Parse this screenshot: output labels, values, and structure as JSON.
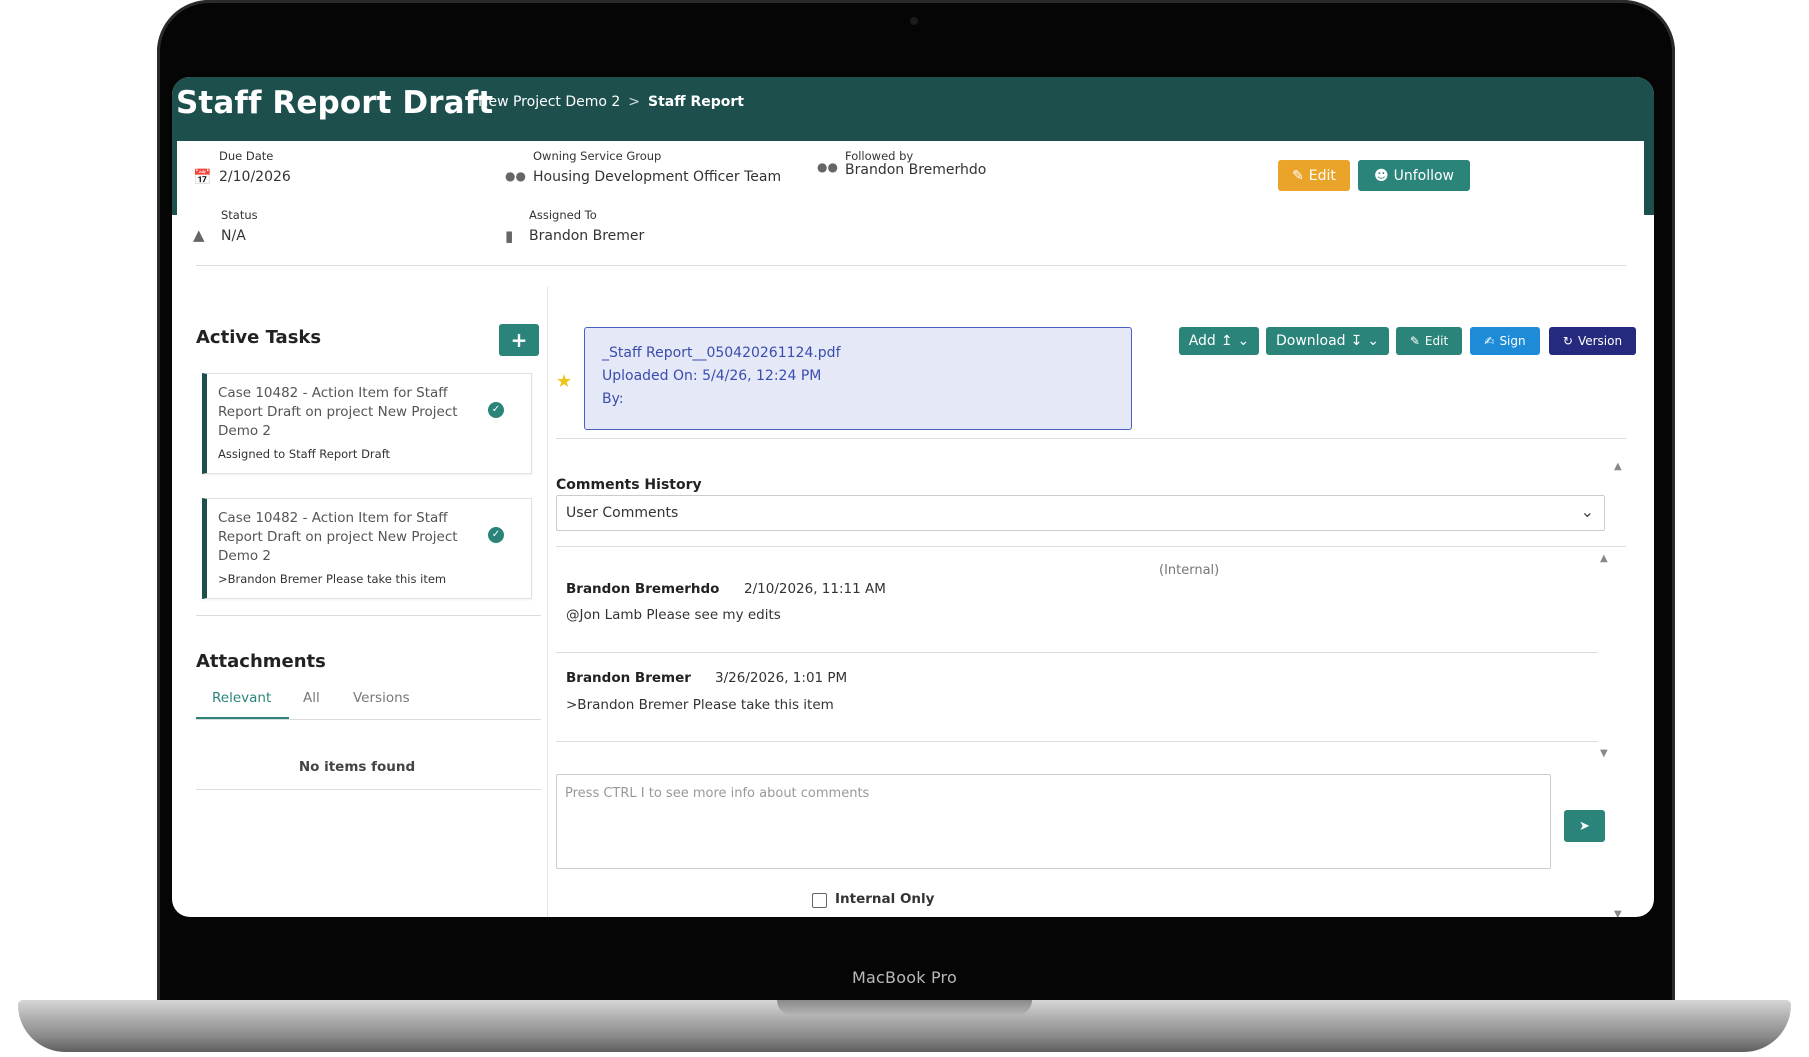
{
  "device": {
    "label": "MacBook Pro"
  },
  "header": {
    "title": "Staff Report Draft",
    "breadcrumb": {
      "project": "New Project Demo 2",
      "separator": ">",
      "current": "Staff Report"
    }
  },
  "details": {
    "due_date": {
      "label": "Due Date",
      "value": "2/10/2026"
    },
    "owning_group": {
      "label": "Owning Service Group",
      "value": "Housing Development Officer Team"
    },
    "followed_by": {
      "label": "Followed by",
      "value": "Brandon Bremerhdo"
    },
    "status": {
      "label": "Status",
      "value": "N/A"
    },
    "assigned_to": {
      "label": "Assigned To",
      "value": "Brandon Bremer"
    },
    "edit_label": "Edit",
    "unfollow_label": "Unfollow"
  },
  "tasks": {
    "title": "Active Tasks",
    "add_label": "+",
    "items": [
      {
        "title": "Case 10482 - Action Item for Staff Report Draft on project New Project Demo 2",
        "sub": "Assigned to Staff Report Draft"
      },
      {
        "title": "Case 10482 - Action Item for Staff Report Draft on project New Project Demo 2",
        "sub": ">Brandon Bremer Please take this item"
      }
    ]
  },
  "attachments": {
    "title": "Attachments",
    "tabs": [
      "Relevant",
      "All",
      "Versions"
    ],
    "empty": "No items found"
  },
  "document": {
    "filename": "_Staff Report__050420261124.pdf",
    "uploaded": "Uploaded On: 5/4/26, 12:24 PM",
    "by": "By:",
    "buttons": {
      "add": "Add",
      "download": "Download",
      "edit": "Edit",
      "sign": "Sign",
      "version": "Version"
    }
  },
  "comments": {
    "history_label": "Comments History",
    "select_value": "User Comments",
    "internal_tag": "(Internal)",
    "items": [
      {
        "author": "Brandon Bremerhdo",
        "date": "2/10/2026, 11:11 AM",
        "body": "@Jon Lamb Please see my edits"
      },
      {
        "author": "Brandon Bremer",
        "date": "3/26/2026, 1:01 PM",
        "body": ">Brandon Bremer Please take this item"
      }
    ],
    "input_placeholder": "Press CTRL I to see more info about comments",
    "internal_only_label": "Internal Only"
  },
  "colors": {
    "header": "#1d4f4d",
    "primary": "#2a8479",
    "edit_top": "#eba42a",
    "sign": "#1e8bd9",
    "version": "#262a7f",
    "doc_card": "#e5e9f7",
    "doc_text": "#3a4cae",
    "star": "#f0c419"
  }
}
